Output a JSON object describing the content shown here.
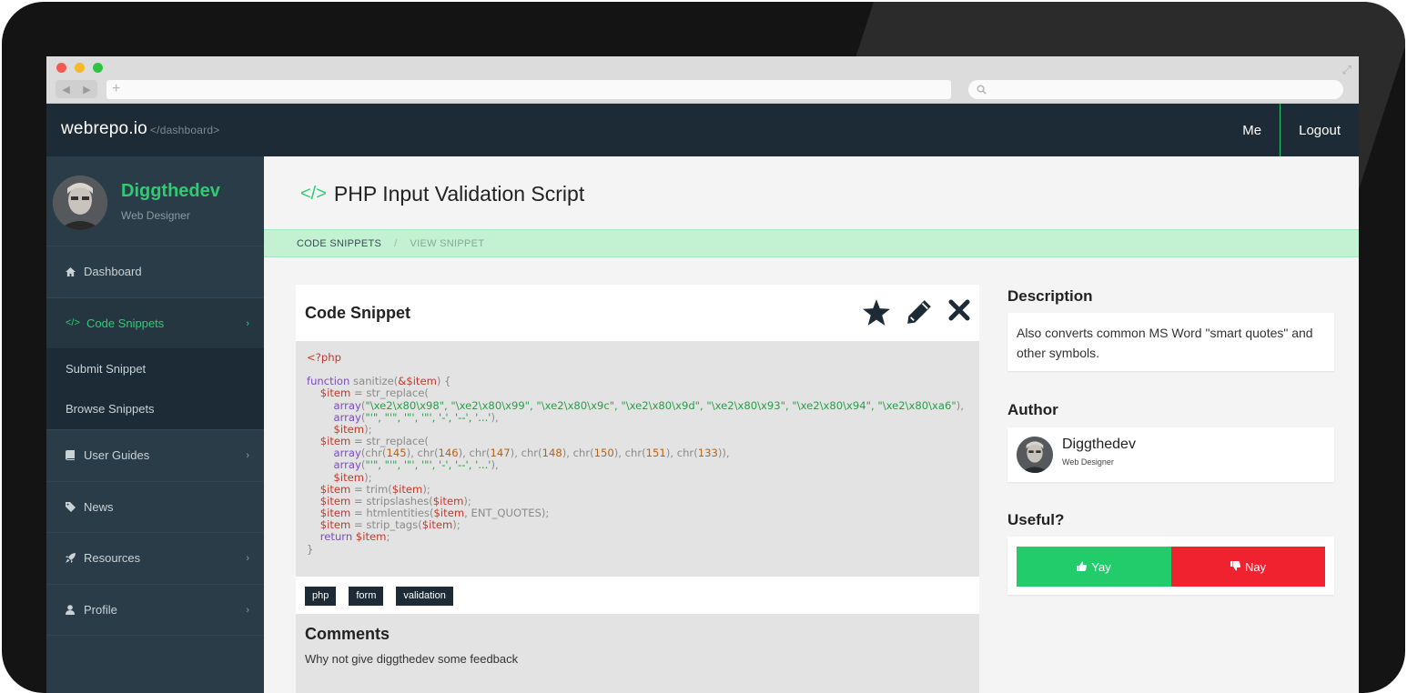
{
  "app": {
    "brand": "webrepo.io",
    "brand_sub": "</dashboard>"
  },
  "topnav": {
    "me": "Me",
    "logout": "Logout"
  },
  "user": {
    "name": "Diggthedev",
    "role": "Web Designer"
  },
  "sidebar": {
    "items": [
      {
        "label": "Dashboard",
        "icon": "home-icon"
      },
      {
        "label": "Code Snippets",
        "icon": "code-icon",
        "active": true
      },
      {
        "label": "User Guides",
        "icon": "book-icon"
      },
      {
        "label": "News",
        "icon": "tag-icon"
      },
      {
        "label": "Resources",
        "icon": "rocket-icon"
      },
      {
        "label": "Profile",
        "icon": "user-icon"
      }
    ],
    "subitems": [
      "Submit Snippet",
      "Browse Snippets"
    ]
  },
  "page": {
    "title": "PHP Input Validation Script"
  },
  "breadcrumb": {
    "first": "CODE SNIPPETS",
    "separator": "/",
    "current": "VIEW SNIPPET"
  },
  "snippet": {
    "title": "Code Snippet",
    "tags": [
      "php",
      "form",
      "validation"
    ]
  },
  "comments": {
    "title": "Comments",
    "prompt": "Why not give diggthedev some feedback"
  },
  "description": {
    "title": "Description",
    "text": "Also converts common MS Word \"smart quotes\" and other symbols."
  },
  "author": {
    "title": "Author",
    "name": "Diggthedev",
    "role": "Web Designer"
  },
  "useful": {
    "title": "Useful?",
    "yay": "Yay",
    "nay": "Nay"
  },
  "colors": {
    "accent": "#2ecc71",
    "header": "#1c2b36",
    "sidebar": "#2a3c47",
    "yay": "#22cc6b",
    "nay": "#f0222f"
  }
}
